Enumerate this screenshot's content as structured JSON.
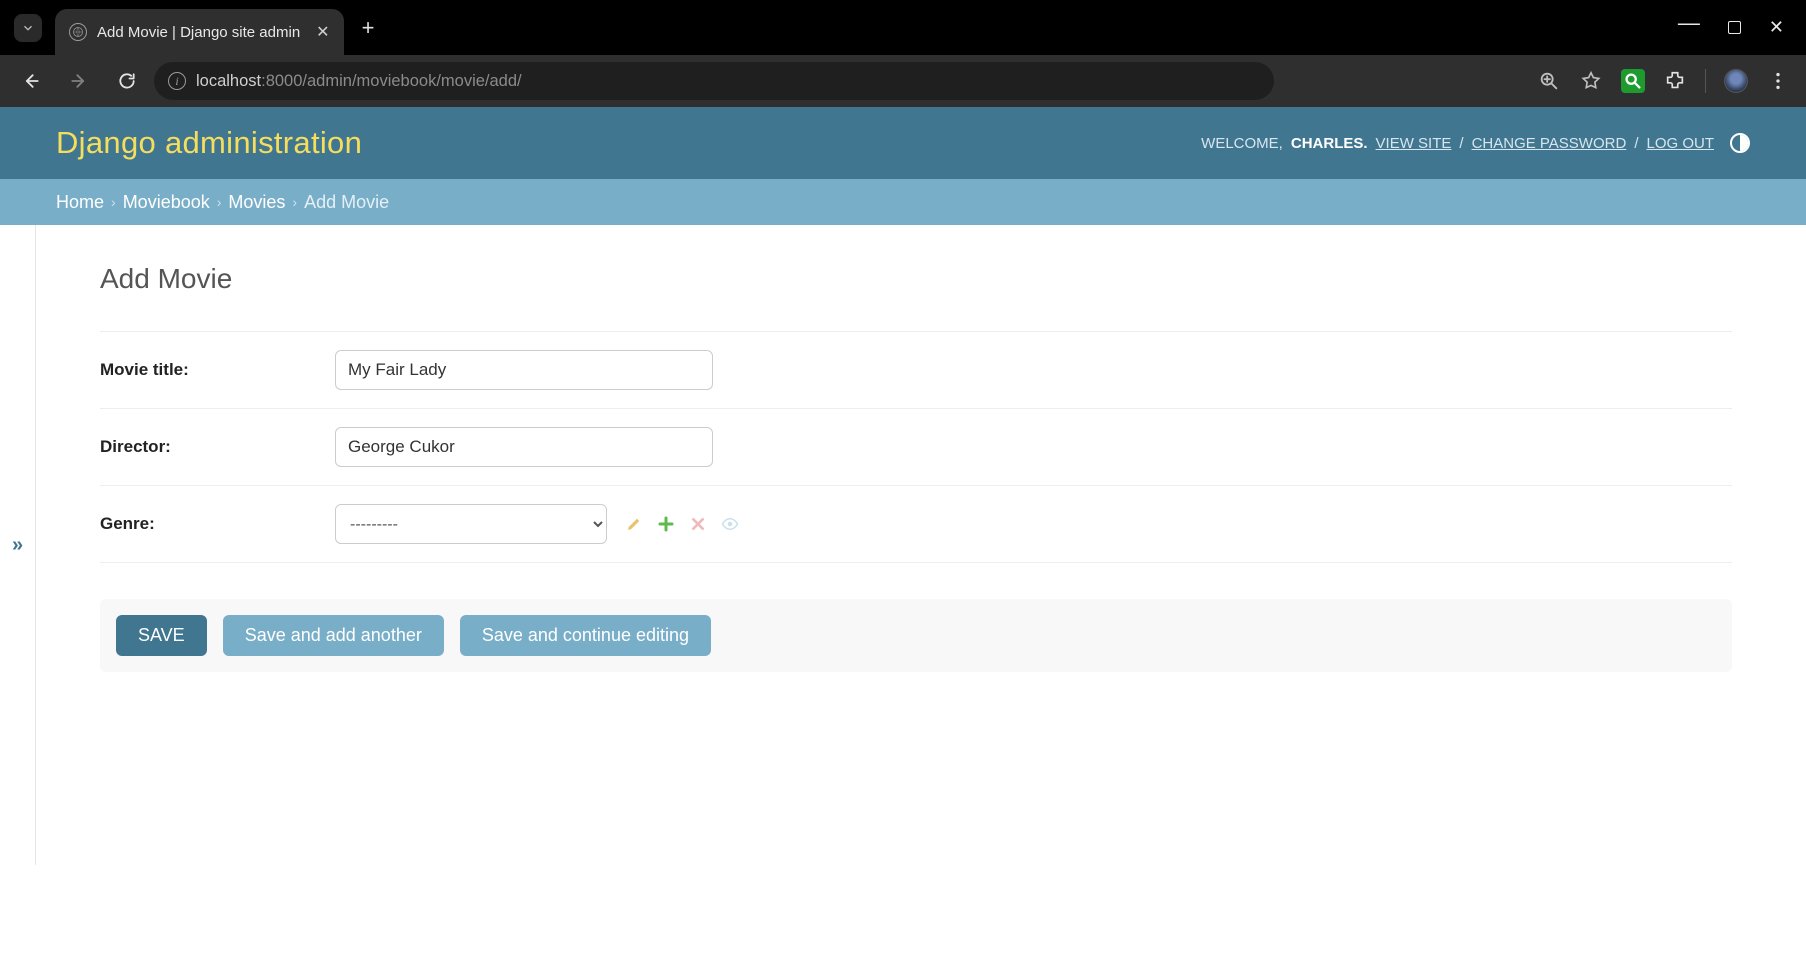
{
  "browser": {
    "tab_title": "Add Movie | Django site admin",
    "url_host": "localhost",
    "url_port_path": ":8000/admin/moviebook/movie/add/"
  },
  "header": {
    "site_title": "Django administration",
    "welcome_prefix": "WELCOME, ",
    "username": "CHARLES",
    "view_site": "VIEW SITE",
    "change_password": "CHANGE PASSWORD",
    "log_out": "LOG OUT"
  },
  "breadcrumbs": {
    "home": "Home",
    "app": "Moviebook",
    "model": "Movies",
    "current": "Add Movie"
  },
  "page": {
    "title": "Add Movie"
  },
  "form": {
    "movie_title": {
      "label": "Movie title:",
      "value": "My Fair Lady"
    },
    "director": {
      "label": "Director:",
      "value": "George Cukor"
    },
    "genre": {
      "label": "Genre:",
      "placeholder": "---------"
    }
  },
  "buttons": {
    "save": "SAVE",
    "save_add_another": "Save and add another",
    "save_continue": "Save and continue editing"
  },
  "side_toggle": "»"
}
